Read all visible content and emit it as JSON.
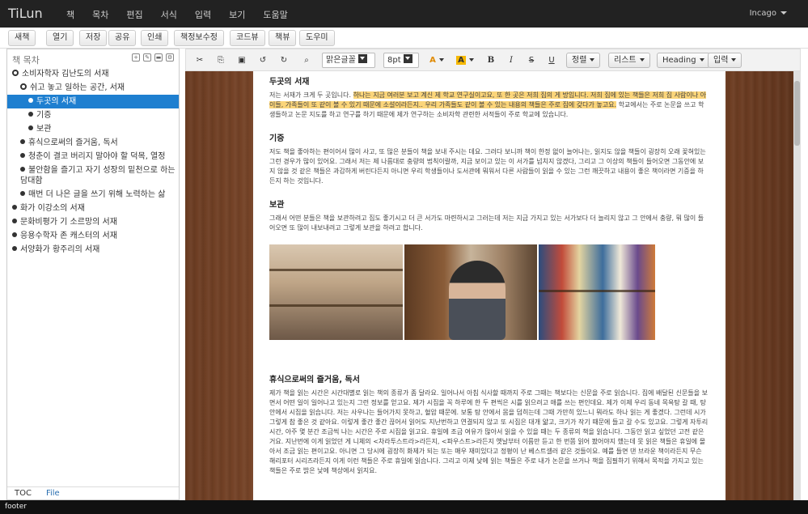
{
  "app": {
    "brand": "TiLun",
    "menu": [
      "책",
      "목차",
      "편집",
      "서식",
      "입력",
      "보기",
      "도움말"
    ],
    "user": "Incago"
  },
  "toolbar2": {
    "buttons": [
      "새책",
      "열기",
      "저장",
      "공유",
      "인쇄",
      "책정보수정",
      "코드뷰",
      "책뷰",
      "도우미"
    ]
  },
  "sidebar": {
    "title": "책 목차",
    "header_icons": [
      "add-icon",
      "edit-icon",
      "delete-icon",
      "settings-icon"
    ],
    "tree": [
      {
        "label": "소비자학자 김난도의 서재",
        "kind": "toggle",
        "level": 0
      },
      {
        "label": "쉬고 놓고 일하는 공간, 서재",
        "kind": "toggle",
        "level": 1
      },
      {
        "label": "두곳의 서재",
        "kind": "bullet",
        "level": 2,
        "selected": true
      },
      {
        "label": "기증",
        "kind": "bullet",
        "level": 2
      },
      {
        "label": "보관",
        "kind": "bullet",
        "level": 2
      },
      {
        "label": "휴식으로써의 즐거움, 독서",
        "kind": "bullet",
        "level": 1
      },
      {
        "label": "청춘이 결코 버리지 말아야 할 덕목, 열정",
        "kind": "bullet",
        "level": 1
      },
      {
        "label": "불안함을 즐기고 자기 성장의 밑천으로 하는 담대함",
        "kind": "bullet",
        "level": 1
      },
      {
        "label": "매번 더 나은 글을 쓰기 위해 노력하는 삶",
        "kind": "bullet",
        "level": 1
      },
      {
        "label": "화가 이강소의 서재",
        "kind": "bullet",
        "level": 0
      },
      {
        "label": "문화비평가 기 소르망의 서재",
        "kind": "bullet",
        "level": 0
      },
      {
        "label": "응용수학자 존 캐스터의 서재",
        "kind": "bullet",
        "level": 0
      },
      {
        "label": "서양화가 황주리의 서재",
        "kind": "bullet",
        "level": 0
      }
    ],
    "tabs": [
      "TOC",
      "File"
    ]
  },
  "editor_toolbar": {
    "icons": [
      "cut-icon",
      "copy-icon",
      "paste-icon",
      "undo-icon",
      "redo-icon",
      "find-icon"
    ],
    "font": "맑은글꼴",
    "size": "8pt",
    "color_a": "A",
    "highlight_a": "A",
    "bold": "B",
    "italic": "I",
    "strike": "S",
    "underline": "U",
    "align": "정렬",
    "list": "리스트",
    "heading": "Heading",
    "insert": "입력"
  },
  "document": {
    "sec1_title": "두곳의 서재",
    "sec1_p_before": "저는 서재가 크게 두 곳입니다. ",
    "sec1_p_highlight": "하나는 지금 여러분 보고 계신 제 학교 연구실이고요, 또 한 곳은 저희 집의 게 방입니다. 저희 집에 있는 책들은 저희 집 사람이나 아이들, 가족들이 또 같이 볼 수 있기 때문에 소설이라든지.. 우리 가족들도 같이 볼 수 있는 내용의 책들은 주로 집에 갖다가 놓고요.",
    "sec1_p_after": " 학교에서는 주로 논문을 쓰고 학생들하고 논문 지도를 하고 연구를 하기 때문에 제가 연구하는 소비자학 관련한 서적들이 주로 학교에 있습니다.",
    "sec2_title": "기증",
    "sec2_p": "저도 책을 좋아하는 편이어서 많이 사고, 또 많은 분들이 책을 보내 주시는 데요. 그러다 보니까 책이 한정 없이 늘어나는, 읽지도 않을 책들이 굉장히 오래 꽂혀있는 그런 경우가 많이 있어요. 그래서 저는 제 나름대로 충량의 법칙이랄까, 지금 보이고 있는 이 서가를 넘치지 않겠다, 그리고 그 이상의 책들이 들어오면 그동안에 보지 않을 것 같은 책들은 과감하게 버린다든지 아니면 우리 학생들이나 도서관에 뭐워서 다른 사람들이 읽을 수 있는 그런 깨끗하고 내용이 좋은 책이라면 기증을 하든지 하는 것입니다.",
    "sec3_title": "보관",
    "sec3_p": "그래서 어떤 분들은 책을 보관하려고 집도 좋기시고 더 큰 서가도 마련하시고 그러는데 저는 지금 가지고 있는 서가보다 더 늘리지 않고 그 안에서 충량, 뭐 많이 들어오면 또 많이 내보내려고 그렇게 보관을 하려고 합니다.",
    "sec4_title": "휴식으로써의 즐거움, 독서",
    "sec4_p": "제가 책을 읽는 시간은 시간대별로 읽는 책의 종류가 좀 달라요. 일어나서 아침 식사할 때까지 주로 그때는 책보다는 신문을 주로 읽습니다. 집에 배달된 신문들을 보면서 어떤 일이 일어나고 있는지 그런 정보를 얻고요. 제가 시집을 꼭 하루에 한 두 편씩은 시를 읽으려고 애를 쓰는 편인데요. 제가 이제 우리 동네 목욕탕 갈 때, 탕 안에서 시집을 읽습니다. 저는 사우나는 들어가지 못하고, 혈압 때문에. 보통 탕 안에서 몸을 덥히는데 그때 가만히 있느니 뭐라도 하나 읽는 게 좋겠다. 그런데 시가 그렇게 참 좋은 것 같아요. 이렇게 좋간 좋간 끊어서 읽어도 지난번하고 연결되지 않고 또 시집은 대개 얇고, 크기가 작기 때문에 들고 갈 수도 있고요. 그렇게 자투리 시간, 아주 몇 분간 조금씩 나는 시간은 주로 시집을 읽고요. 휴일에 조금 여유가 많아서 읽을 수 있을 때는 두 종류의 책을 읽습니다. 그동안 읽고 싶었던 고전 같은 거요. 지난번에 이게 읽었던 게 니체의 <차라투스트라>라든지, <파우스트>라든지 옛날부터 이름만 듣고 한 번쯤 읽어 봤어야지 했는데 못 읽은 책들은 휴일에 몰아서 조금 읽는 편이고요. 아니면 그 당시에 굉장히 화제가 되는 또는 매우 재미있다고 정평이 난 베스트셀러 같은 것들이요. 예를 들면 댄 브라운 책이라든지 무슨 해리포터 시리즈라든지 이게 이런 책들은 주로 휴일에 읽습니다. 그리고 이제 낮에 읽는 책들은 주로 내가 논문을 쓰거나 책을 집필하기 위해서 목적을 가지고 있는 책들은 주로 밝은 낮에 책상에서 읽지요."
  },
  "footer": "footer"
}
